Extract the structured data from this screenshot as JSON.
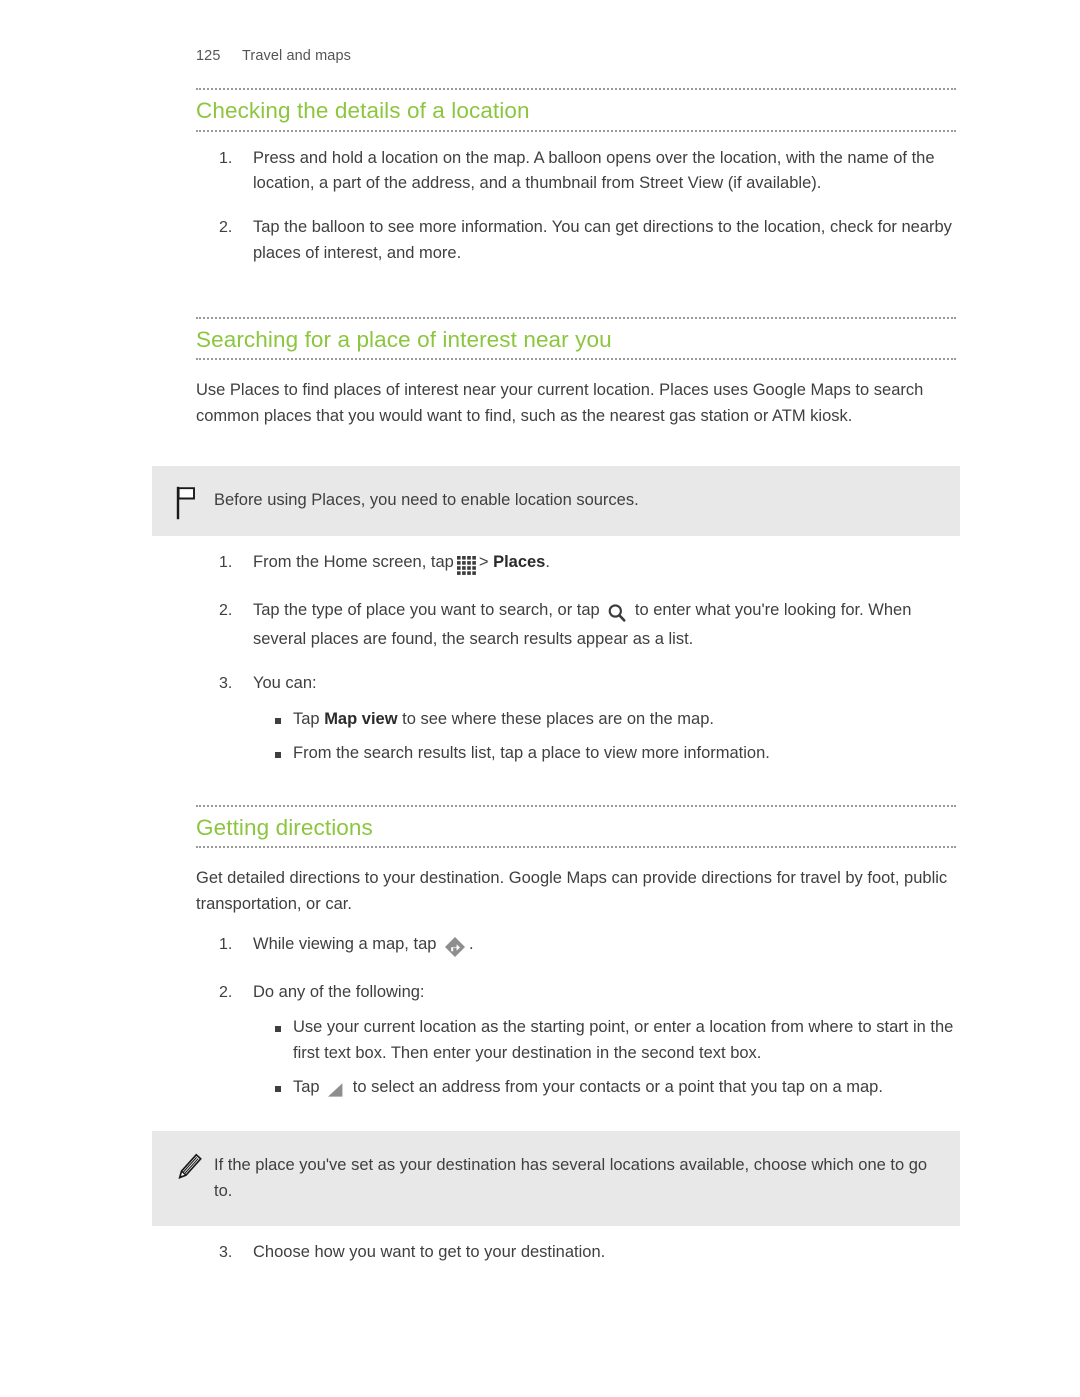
{
  "header": {
    "page_number": "125",
    "chapter": "Travel and maps"
  },
  "colors": {
    "heading_green": "#8cc63f",
    "body_text": "#3f3f3f",
    "note_background": "#e8e8e8",
    "rule_dots": "#9a9a9a"
  },
  "sections": [
    {
      "heading": "Checking the details of a location",
      "steps": [
        {
          "num": "1.",
          "text": "Press and hold a location on the map. A balloon opens over the location, with the name of the location, a part of the address, and a thumbnail from Street View (if available)."
        },
        {
          "num": "2.",
          "text": "Tap the balloon to see more information. You can get directions to the location, check for nearby places of interest, and more."
        }
      ]
    },
    {
      "heading": "Searching for a place of interest near you",
      "intro": "Use Places to find places of interest near your current location. Places uses Google Maps to search common places that you would want to find, such as the nearest gas station or ATM kiosk.",
      "note": {
        "icon": "flag-icon",
        "text": "Before using Places, you need to enable location sources."
      },
      "steps": [
        {
          "num": "1.",
          "text_before": "From the Home screen, tap",
          "icon": "apps-grid-icon",
          "text_mid": "> ",
          "bold": "Places",
          "text_after": "."
        },
        {
          "num": "2.",
          "text_before": "Tap the type of place you want to search, or tap",
          "icon": "search-icon",
          "text_after": "to enter what you're looking for. When several places are found, the search results appear as a list."
        },
        {
          "num": "3.",
          "text": "You can:",
          "bullets": [
            {
              "text_before": "Tap ",
              "bold": "Map view",
              "text_after": " to see where these places are on the map."
            },
            {
              "text_before": "From the search results list, tap a place to view more information."
            }
          ]
        }
      ]
    },
    {
      "heading": "Getting directions",
      "intro": "Get detailed directions to your destination. Google Maps can provide directions for travel by foot, public transportation, or car.",
      "steps": [
        {
          "num": "1.",
          "text_before": "While viewing a map, tap",
          "icon": "directions-diamond-icon",
          "text_after": "."
        },
        {
          "num": "2.",
          "text": "Do any of the following:",
          "bullets": [
            {
              "text_before": "Use your current location as the starting point, or enter a location from where to start in the first text box. Then enter your destination in the second text box."
            },
            {
              "text_before": "Tap ",
              "icon": "triangle-picker-icon",
              "text_after": " to select an address from your contacts or a point that you tap on a map."
            }
          ]
        }
      ],
      "note": {
        "icon": "pencil-icon",
        "text": "If the place you've set as your destination has several locations available, choose which one to go to."
      },
      "final_step": {
        "num": "3.",
        "text": "Choose how you want to get to your destination."
      }
    }
  ]
}
